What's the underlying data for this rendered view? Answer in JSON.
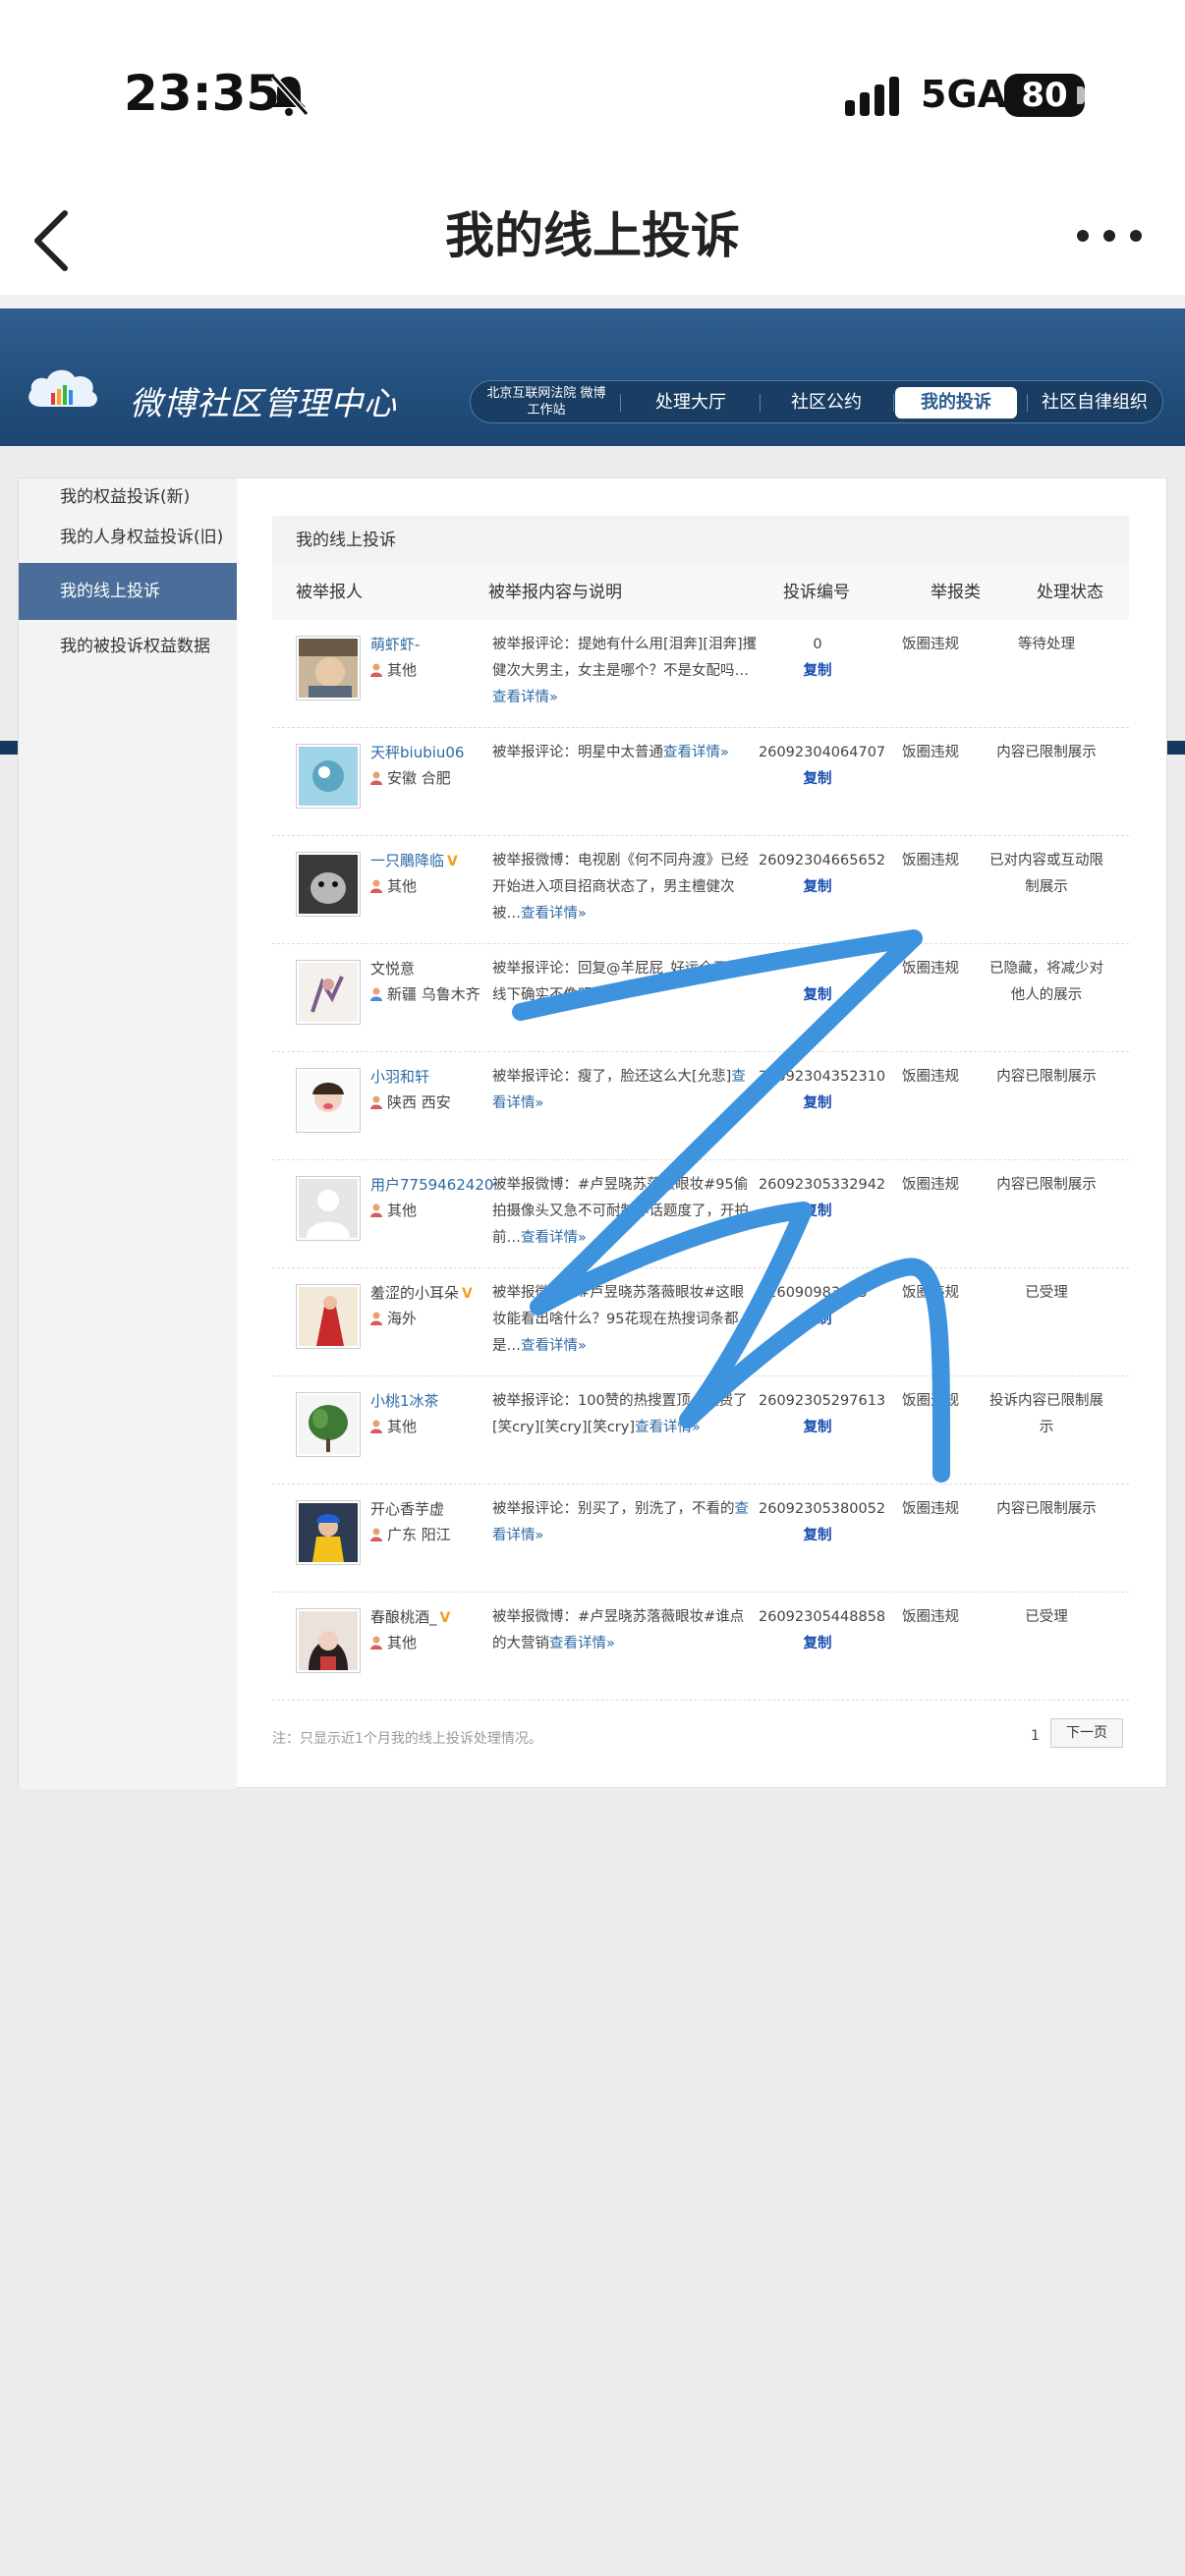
{
  "status_bar": {
    "time": "23:35",
    "network": "5GA",
    "battery": "80"
  },
  "nav": {
    "title": "我的线上投诉"
  },
  "site": {
    "title": "微博社区管理中心"
  },
  "tabs": {
    "court": "北京互联网法院 微博工作站",
    "t1": "处理大厅",
    "t2": "社区公约",
    "t3": "我的投诉",
    "t4": "社区自律组织"
  },
  "sidebar": {
    "items": [
      "我的权益投诉(新)",
      "我的人身权益投诉(旧)",
      "我的线上投诉",
      "我的被投诉权益数据"
    ]
  },
  "main": {
    "header": "我的线上投诉",
    "columns": [
      "被举报人",
      "被举报内容与说明",
      "投诉编号",
      "举报类",
      "处理状态"
    ],
    "copy_label": "复制",
    "rows": [
      {
        "name": "萌虾虾-",
        "loc": "其他",
        "content": "被举报评论：提她有什么用[泪奔][泪奔]攫健次大男主，女主是哪个？不是女配吗…",
        "detail": "查看详情»",
        "id": "0",
        "cat": "饭圈违规",
        "status": "等待处理"
      },
      {
        "name": "天秤biubiu06",
        "loc": "安徽 合肥",
        "content": "被举报评论：明星中太普通",
        "detail": "查看详情»",
        "id": "26092304064707",
        "cat": "饭圈违规",
        "status": "内容已限制展示"
      },
      {
        "name": "一只鵰降临",
        "loc": "其他",
        "content": "被举报微博：电视剧《何不同舟渡》已经开始进入项目招商状态了，男主檀健次被…",
        "detail": "查看详情»",
        "id": "26092304665652",
        "cat": "饭圈违规",
        "status": "已对内容或互动限制展示"
      },
      {
        "name": "文悦意",
        "loc": "新疆 乌鲁木齐",
        "content": "被举报评论：回复@羊屁屁_好运全开版：线下确实不像明星",
        "detail": "",
        "id": "",
        "cat": "饭圈违规",
        "status": "已隐藏，将减少对他人的展示"
      },
      {
        "name": "小羽和轩",
        "loc": "陕西 西安",
        "content": "被举报评论：瘦了，脸还这么大[允悲]",
        "detail": "查看详情»",
        "id": "26092304352310",
        "cat": "饭圈违规",
        "status": "内容已限制展示"
      },
      {
        "name": "用户7759462420",
        "loc": "其他",
        "content": "被举报微博：#卢昱晓苏落薇眼妆#95偷拍摄像头又急不可耐制作话题度了，开拍前…",
        "detail": "查看详情»",
        "id": "26092305332942",
        "cat": "饭圈违规",
        "status": "内容已限制展示"
      },
      {
        "name": "羞涩的小耳朵",
        "loc": "海外",
        "content": "被举报微博：#卢昱晓苏落薇眼妆#这眼妆能看出啥什么？95花现在热搜词条都是…",
        "detail": "查看详情»",
        "id": "26090983925",
        "cat": "饭圈违规",
        "status": "已受理"
      },
      {
        "name": "小桃1冰茶",
        "loc": "其他",
        "content": "被举报评论：100赞的热搜置顶，浪费了[笑cry][笑cry][笑cry]",
        "detail": "查看详情»",
        "id": "26092305297613",
        "cat": "饭圈违规",
        "status": "投诉内容已限制展示"
      },
      {
        "name": "开心香芋虚",
        "loc": "广东 阳江",
        "content": "被举报评论：别买了，别洗了，不看的",
        "detail": "查看详情»",
        "id": "26092305380052",
        "cat": "饭圈违规",
        "status": "内容已限制展示"
      },
      {
        "name": "春酿桃酒_",
        "loc": "其他",
        "content": "被举报微博：#卢昱晓苏落薇眼妆#谁点的大营销",
        "detail": "查看详情»",
        "id": "26092305448858",
        "cat": "饭圈违规",
        "status": "已受理"
      }
    ]
  },
  "footer": {
    "note": "注：只显示近1个月我的线上投诉处理情况。",
    "page": "1",
    "next": "下一页"
  },
  "colors": {
    "accent": "#2c6aa5",
    "banner": "#24517f",
    "scribble": "#3d93de",
    "vip": "#f0a020"
  }
}
